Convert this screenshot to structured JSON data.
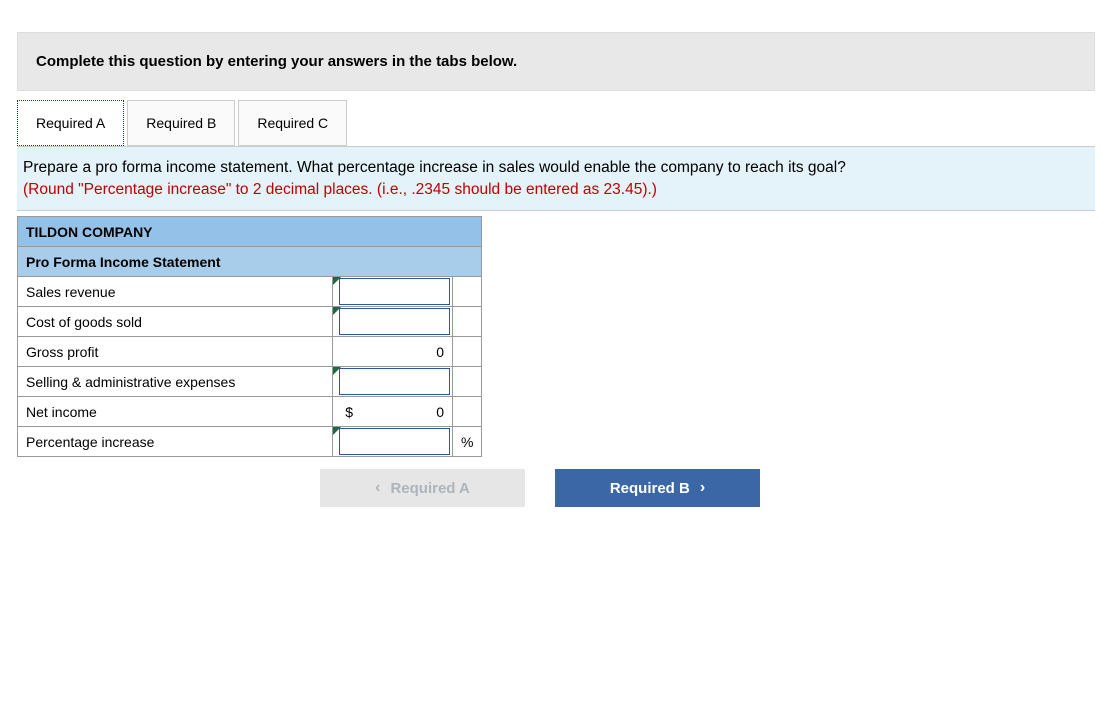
{
  "header": {
    "instruction": "Complete this question by entering your answers in the tabs below."
  },
  "tabs": [
    {
      "label": "Required A",
      "active": true
    },
    {
      "label": "Required B",
      "active": false
    },
    {
      "label": "Required C",
      "active": false
    }
  ],
  "prompt": {
    "main": "Prepare a pro forma income statement. What percentage increase in sales would enable the company to reach its goal?",
    "note": "(Round \"Percentage increase\" to 2 decimal places. (i.e., .2345 should be entered as 23.45).)"
  },
  "table": {
    "title1": "TILDON COMPANY",
    "title2": "Pro Forma Income Statement",
    "rows": {
      "sales_revenue": {
        "label": "Sales revenue",
        "value": "",
        "editable": true,
        "unit": ""
      },
      "cogs": {
        "label": "Cost of goods sold",
        "value": "",
        "editable": true,
        "unit": ""
      },
      "gross_profit": {
        "label": "Gross profit",
        "value": "0",
        "editable": false,
        "unit": ""
      },
      "sga": {
        "label": "Selling & administrative expenses",
        "value": "",
        "editable": true,
        "unit": ""
      },
      "net_income": {
        "label": "Net income",
        "prefix": "$",
        "value": "0",
        "editable": false,
        "unit": ""
      },
      "pct_increase": {
        "label": "Percentage increase",
        "value": "",
        "editable": true,
        "unit": "%"
      }
    }
  },
  "nav": {
    "prev": {
      "icon": "‹",
      "label": "Required A"
    },
    "next": {
      "label": "Required B",
      "icon": "›"
    }
  }
}
